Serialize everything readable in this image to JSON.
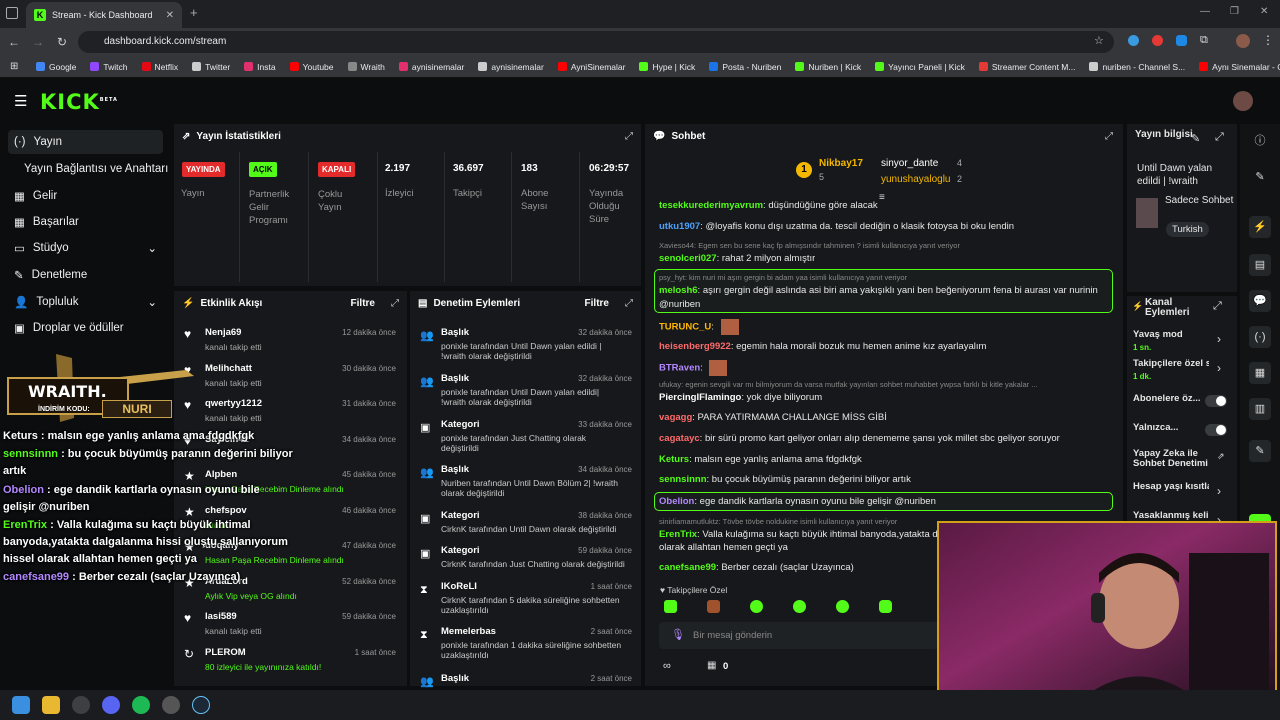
{
  "browser": {
    "tab_title": "Stream - Kick Dashboard",
    "url": "dashboard.kick.com/stream",
    "bookmarks": [
      {
        "label": "Google",
        "color": "#4285f4"
      },
      {
        "label": "Twitch",
        "color": "#9146ff"
      },
      {
        "label": "Netflix",
        "color": "#e50914"
      },
      {
        "label": "Twitter",
        "color": "#cccccc"
      },
      {
        "label": "Insta",
        "color": "#e1306c"
      },
      {
        "label": "Youtube",
        "color": "#ff0000"
      },
      {
        "label": "Wraith",
        "color": "#888888"
      },
      {
        "label": "aynisinemalar",
        "color": "#e1306c"
      },
      {
        "label": "aynisinemalar",
        "color": "#cccccc"
      },
      {
        "label": "AyniSinemalar",
        "color": "#ff0000"
      },
      {
        "label": "Hype | Kick",
        "color": "#53fc18"
      },
      {
        "label": "Posta - Nuriben",
        "color": "#1a73e8"
      },
      {
        "label": "Nuriben | Kick",
        "color": "#53fc18"
      },
      {
        "label": "Yayıncı Paneli | Kick",
        "color": "#53fc18"
      },
      {
        "label": "Streamer Content M...",
        "color": "#e53935"
      },
      {
        "label": "nuriben - Channel S...",
        "color": "#cccccc"
      },
      {
        "label": "Aynı Sinemalar - Ça...",
        "color": "#ff0000"
      }
    ]
  },
  "kick": {
    "logo": "KICK",
    "logo_sup": "BETA"
  },
  "sidebar": {
    "items": [
      {
        "label": "Yayın",
        "icon": "(·)"
      },
      {
        "label": "Yayın Bağlantısı ve Anahtarı",
        "icon": ""
      },
      {
        "label": "Gelir",
        "icon": "▦"
      },
      {
        "label": "Başarılar",
        "icon": "▦"
      },
      {
        "label": "Stüdyo",
        "icon": "▭",
        "chev": "⌄"
      },
      {
        "label": "Denetleme",
        "icon": "✎"
      },
      {
        "label": "Topluluk",
        "icon": "👤",
        "chev": "⌄"
      },
      {
        "label": "Droplar ve ödüller",
        "icon": "▣"
      }
    ]
  },
  "stats": {
    "title": "Yayın İstatistikleri",
    "badges": [
      {
        "text": "YAYINDA",
        "bg": "#e32b2b",
        "color": "#fff",
        "label": "Yayın"
      },
      {
        "text": "AÇIK",
        "bg": "#53fc18",
        "color": "#000",
        "label": "Partnerlik Gelir Programı"
      },
      {
        "text": "KAPALI",
        "bg": "#e32b2b",
        "color": "#fff",
        "label": "Çoklu Yayın"
      }
    ],
    "numbers": [
      {
        "value": "2.197",
        "label": "İzleyici"
      },
      {
        "value": "36.697",
        "label": "Takipçi"
      },
      {
        "value": "183",
        "label": "Abone Sayısı"
      },
      {
        "value": "06:29:57",
        "label": "Yayında Olduğu Süre"
      }
    ]
  },
  "activity": {
    "title": "Etkinlik Akışı",
    "filter": "Filtre",
    "items": [
      {
        "name": "Nenja69",
        "desc": "kanalı takip etti",
        "time": "12 dakika önce",
        "icon": "♥"
      },
      {
        "name": "Melihchatt",
        "desc": "kanalı takip etti",
        "time": "30 dakika önce",
        "icon": "♥"
      },
      {
        "name": "qwertyy1212",
        "desc": "kanalı takip etti",
        "time": "31 dakika önce",
        "icon": "♥"
      },
      {
        "name": "Sayıcın42",
        "desc": "",
        "time": "34 dakika önce",
        "icon": "♥"
      },
      {
        "name": "Alpben",
        "desc": "Hasan Paşa Recebim Dinleme alındı",
        "time": "45 dakika önce",
        "icon": "★"
      },
      {
        "name": "chefspov",
        "desc": "alındı",
        "time": "46 dakika önce",
        "icon": "★"
      },
      {
        "name": "doqany",
        "desc": "Hasan Paşa Recebim Dinleme alındı",
        "time": "47 dakika önce",
        "icon": "★"
      },
      {
        "name": "ArdaLord",
        "desc": "Aylık Vip veya OG alındı",
        "time": "52 dakika önce",
        "icon": "★"
      },
      {
        "name": "lasi589",
        "desc": "kanalı takip etti",
        "time": "59 dakika önce",
        "icon": "♥"
      },
      {
        "name": "PLEROM",
        "desc": "80 izleyici ile yayınınıza katıldı!",
        "time": "1 saat önce",
        "icon": "↻"
      }
    ]
  },
  "moderation": {
    "title": "Denetim Eylemleri",
    "filter": "Filtre",
    "items": [
      {
        "name": "Başlık",
        "l1": "ponixle tarafından Until Dawn yalan edildi |",
        "l2": "!wraith olarak değiştirildi",
        "time": "32 dakika önce",
        "icon": "👥"
      },
      {
        "name": "Başlık",
        "l1": "ponixle tarafından Until Dawn yalan edildi|",
        "l2": "!wraith olarak değiştirildi",
        "time": "32 dakika önce",
        "icon": "👥"
      },
      {
        "name": "Kategori",
        "l1": "ponixle tarafından Just Chatting olarak",
        "l2": "değiştirildi",
        "time": "33 dakika önce",
        "icon": "▣"
      },
      {
        "name": "Başlık",
        "l1": "Nuriben tarafından Until Dawn Bölüm 2| !wraith",
        "l2": "olarak değiştirildi",
        "time": "34 dakika önce",
        "icon": "👥"
      },
      {
        "name": "Kategori",
        "l1": "CirknK tarafından Until Dawn olarak değiştirildi",
        "l2": "",
        "time": "38 dakika önce",
        "icon": "▣"
      },
      {
        "name": "Kategori",
        "l1": "CirknK tarafından Just Chatting olarak değiştirildi",
        "l2": "",
        "time": "59 dakika önce",
        "icon": "▣"
      },
      {
        "name": "IKoReLI",
        "l1": "CirknK tarafından 5 dakika süreliğine sohbetten",
        "l2": "uzaklaştırıldı",
        "time": "1 saat önce",
        "icon": "⧗"
      },
      {
        "name": "Memelerbas",
        "l1": "ponixle tarafından 1 dakika süreliğine sohbetten",
        "l2": "uzaklaştırıldı",
        "time": "2 saat önce",
        "icon": "⧗"
      },
      {
        "name": "Başlık",
        "l1": "",
        "l2": "",
        "time": "2 saat önce",
        "icon": "👥"
      }
    ]
  },
  "chat": {
    "title": "Sohbet",
    "top": [
      {
        "name": "Nikbay17",
        "count": "5"
      },
      {
        "name": "sinyor_dante",
        "count": "4"
      },
      {
        "name": "yunushayaloglu",
        "count": "2"
      }
    ],
    "messages": [
      {
        "user": "tesekkurederimyavrum",
        "color": "#53fc18",
        "text": "düşündüğüne göre alacak"
      },
      {
        "user": "utku1907",
        "color": "#4da3ff",
        "text": "@loyafis konu dışı uzatma da. tescil dediğin o klasik fotoysa bi oku lendin"
      },
      {
        "user": "",
        "color": "#888",
        "text": "Xavieso44: Egem sen bu sene kaç fp almışsındır tahminen ? isimli kullanıcıya yanıt veriyor"
      },
      {
        "user": "senolceri027",
        "color": "#53fc18",
        "text": "rahat 2 milyon almıştır"
      },
      {
        "user": "",
        "color": "#888",
        "text": "psy_hyt: kim nuri mi aşırı gergin bi adam yaa isimli kullanıcıya yanıt veriyor"
      },
      {
        "user": "melosh6",
        "color": "#53fc18",
        "text": "aşırı gergin değil aslında asi biri ama yakışıklı yani ben beğeniyorum fena bi aurası var nurinin"
      },
      {
        "user": "",
        "color": "#e8e8e8",
        "text": "@nuriben"
      },
      {
        "user": "TURUNC_U",
        "color": "#ffb800",
        "text": ""
      },
      {
        "user": "heisenberg9922",
        "color": "#ff6b6b",
        "text": "egemin hala morali bozuk mu hemen anime kız ayarlayalım"
      },
      {
        "user": "BTRaven",
        "color": "#b388ff",
        "text": ""
      },
      {
        "user": "",
        "color": "#888",
        "text": "ufukay: egenin sevgili var mı bilmiyorum da varsa mutfak yayınları sohbet muhabbet ywpsa farklı bi kitle yakalar ..."
      },
      {
        "user": "PiercingIFlamingo",
        "color": "#ffffff",
        "text": "yok diye biliyorum"
      },
      {
        "user": "vagagg",
        "color": "#ff6b6b",
        "text": "PARA YATIRMAMA CHALLANGE MİSS GİBİ"
      },
      {
        "user": "cagatayc",
        "color": "#ff6b6b",
        "text": "bir sürü promo kart geliyor onları alıp denememe şansı yok millet sbc geliyor soruyor"
      },
      {
        "user": "Keturs",
        "color": "#53fc18",
        "text": "malsın ege yanlış anlama ama fdgdkfgk"
      },
      {
        "user": "sennsinnn",
        "color": "#53fc18",
        "text": "bu çocuk büyümüş paranın değerini biliyor artık"
      },
      {
        "user": "Obelion",
        "color": "#b388ff",
        "text": "ege dandik kartlarla oynasın oyunu bile gelişir @nuriben"
      },
      {
        "user": "",
        "color": "#888",
        "text": "sinirliamamutluktz: Tövbe tövbe noldukine isimli kullanıcıya yanıt veriyor"
      },
      {
        "user": "ErenTrix",
        "color": "#53fc18",
        "text": "Valla kulağıma su kaçtı büyük ihtimal banyoda,yatakta dalga"
      },
      {
        "user": "",
        "color": "#e8e8e8",
        "text": "olarak allahtan hemen geçti ya"
      },
      {
        "user": "canefsane99",
        "color": "#53fc18",
        "text": "Berber cezalı (saçlar Uzayınca)"
      }
    ],
    "followers_only": "Takipçilere Özel",
    "input_placeholder": "Bir mesaj gönderin",
    "count": "0"
  },
  "info": {
    "title": "Yayın bilgisi",
    "stream_title": "Until Dawn yalan edildi | !wraith",
    "category": "Sadece Sohbet",
    "language": "Turkish"
  },
  "channel_actions": {
    "title": "Kanal Eylemleri",
    "items": [
      {
        "label": "Yavaş mod",
        "value": "1 sn."
      },
      {
        "label": "Takipçilere özel s",
        "value": "1 dk."
      },
      {
        "label": "Abonelere öz...",
        "value": ""
      },
      {
        "label": "Yalnızca...",
        "value": ""
      },
      {
        "label": "Yapay Zeka ile Sohbet Denetimi",
        "value": ""
      },
      {
        "label": "Hesap yaşı kısıtla",
        "value": ""
      },
      {
        "label": "Yasaklanmış kelin",
        "value": ""
      }
    ]
  },
  "overlay": {
    "brand": "WRAITH.",
    "code_label": "İNDİRİM KODU:",
    "code": "NURI",
    "lines": [
      {
        "user": "Keturs",
        "color": "#ffffff",
        "text": "malsın ege yanlış anlama ama fdgdkfgk"
      },
      {
        "user": "sennsinnn",
        "color": "#53fc18",
        "text": "bu çocuk büyümüş paranın değerini biliyor"
      },
      {
        "user": "",
        "color": "#fff",
        "text": "artık"
      },
      {
        "user": "Obelion",
        "color": "#b388ff",
        "text": "ege dandik kartlarla oynasın oyunu bile"
      },
      {
        "user": "",
        "color": "#fff",
        "text": "gelişir @nuriben"
      },
      {
        "user": "ErenTrix",
        "color": "#53fc18",
        "text": "Valla kulağıma su kaçtı büyük ihtimal"
      },
      {
        "user": "",
        "color": "#fff",
        "text": "banyoda,yatakta dalgalanma hissi oluştu sallanıyorum"
      },
      {
        "user": "",
        "color": "#fff",
        "text": "hissel olarak allahtan hemen geçti ya"
      },
      {
        "user": "canefsane99",
        "color": "#b388ff",
        "text": "Berber cezalı (saçlar Uzayınca)"
      }
    ]
  },
  "colors": {
    "accent": "#53fc18",
    "panel": "#16181b",
    "bg": "#0b0d0f"
  }
}
